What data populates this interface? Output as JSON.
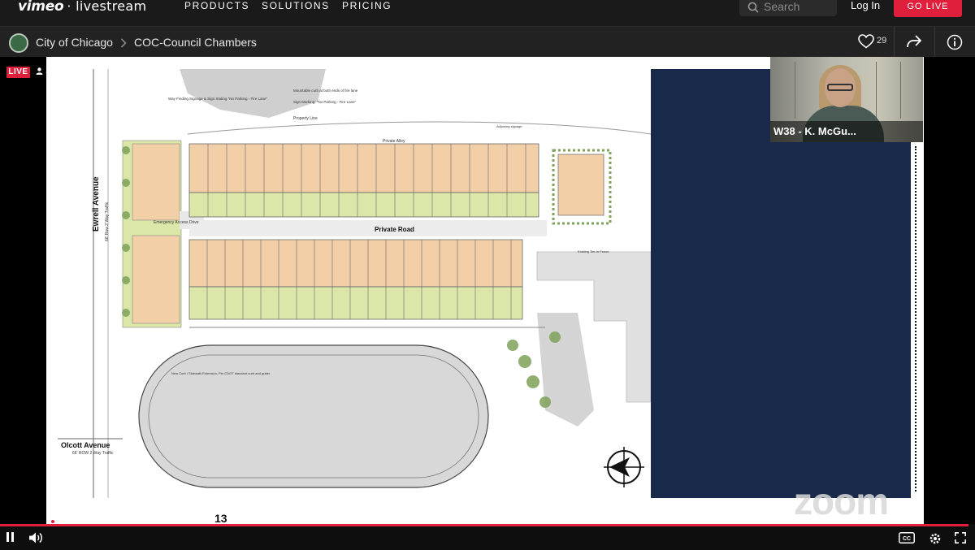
{
  "nav": {
    "brand": "vimeo",
    "brand_sub": "· livestream",
    "links": [
      "PRODUCTS",
      "SOLUTIONS",
      "PRICING"
    ],
    "search_placeholder": "Search",
    "login_label": "Log In",
    "golive_label": "GO LIVE"
  },
  "breadcrumb": {
    "org": "City of Chicago",
    "separator": ">",
    "event": "COC-Council Chambers"
  },
  "actions": {
    "like_count": "29"
  },
  "player": {
    "live_badge": "LIVE",
    "viewer_count": "37",
    "participant_name": "W38 - K. McGu...",
    "watermark": "zoom",
    "page_number": "13",
    "progress_fraction": 0.993
  },
  "plan": {
    "labels": {
      "street_left": "Ewrell Avenue",
      "street_left_sub": "66' Row 2 Way Traffic",
      "street_bottom": "Olcott Avenue",
      "street_bottom_sub": "66' ROW 2 Way Traffic",
      "private_road": "Private Road",
      "private_alley": "Private Alley",
      "emergency": "Emergency Access Drive",
      "existing_fence": "Existing Tee-In Fence",
      "property_line": "Property Line",
      "mountable_curb": "Mountable curb at both ends of fire lane",
      "sign_markers": "Sign Marking: \"No Parking - Fire Lane\"",
      "wayfinding": "Way Finding Signage & Sign Stating \"No Parking - Fire Lane\"",
      "sidewalk_note": "New Curb / Sidewalk Extension, Per CDOT standard curb and gutter",
      "adjoining_signage": "Adjoining signage"
    },
    "colors": {
      "lot_fill": "#f3cfa8",
      "yard_fill": "#dbe7a8",
      "tree": "#7fa25a",
      "navy": "#18294a",
      "accent": "#e01f3d"
    }
  }
}
